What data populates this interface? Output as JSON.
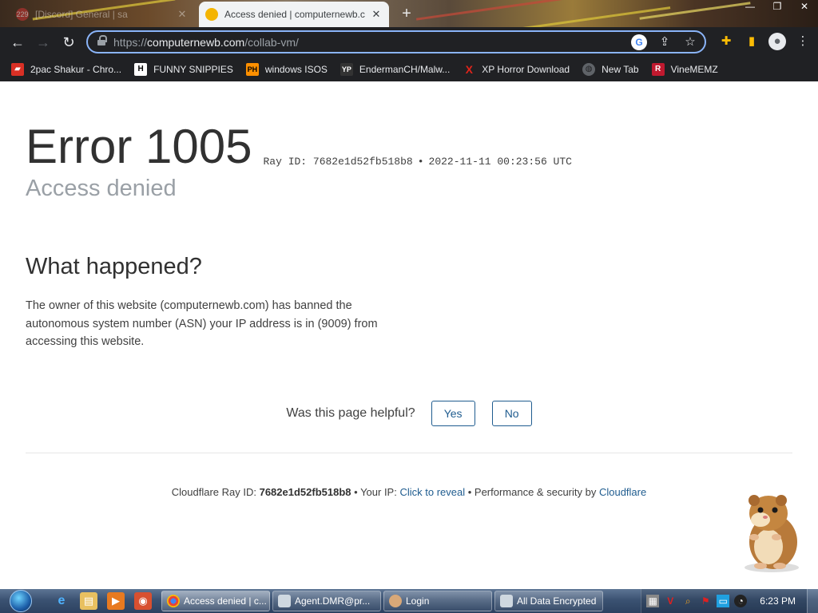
{
  "browser": {
    "tabs": [
      {
        "title": "[Discord] General | sa",
        "badge": "229",
        "state": "inactive"
      },
      {
        "title": "Access denied | computernewb.c",
        "state": "active"
      }
    ],
    "new_tab_label": "+",
    "url_prefix": "https://",
    "url_host": "computernewb.com",
    "url_path": "/collab-vm/",
    "bookmarks": [
      {
        "label": "2pac Shakur - Chro...",
        "icon": "bag-icon"
      },
      {
        "label": "FUNNY SNIPPIES",
        "icon": "H"
      },
      {
        "label": "windows ISOS",
        "icon": "PH"
      },
      {
        "label": "EndermanCH/Malw...",
        "icon": "YP"
      },
      {
        "label": "XP Horror Download",
        "icon": "X"
      },
      {
        "label": "New Tab",
        "icon": "globe-icon"
      },
      {
        "label": "VineMEMZ",
        "icon": "R"
      }
    ]
  },
  "page": {
    "error_code": "Error 1005",
    "ray_label": "Ray ID: 7682e1d52fb518b8",
    "separator": "•",
    "timestamp": "2022-11-11 00:23:56 UTC",
    "subtitle": "Access denied",
    "section_title": "What happened?",
    "description": "The owner of this website (computernewb.com) has banned the autonomous system number (ASN) your IP address is in (9009) from accessing this website.",
    "helpful_question": "Was this page helpful?",
    "yes_label": "Yes",
    "no_label": "No",
    "footer": {
      "ray_prefix": "Cloudflare Ray ID:",
      "ray_id": "7682e1d52fb518b8",
      "ip_prefix": "• Your IP:",
      "ip_link": "Click to reveal",
      "perf_prefix": "• Performance & security by",
      "cf_link": "Cloudflare"
    }
  },
  "taskbar": {
    "tasks": [
      {
        "label": "Access denied | c...",
        "active": true
      },
      {
        "label": "Agent.DMR@pr...",
        "active": false
      },
      {
        "label": "Login",
        "active": false
      },
      {
        "label": "All Data Encrypted",
        "active": false
      }
    ],
    "clock": "6:23 PM"
  },
  "colors": {
    "link": "#1f5c8f",
    "toolbar": "#202124",
    "omnibox_focus": "#8ab4f8"
  }
}
